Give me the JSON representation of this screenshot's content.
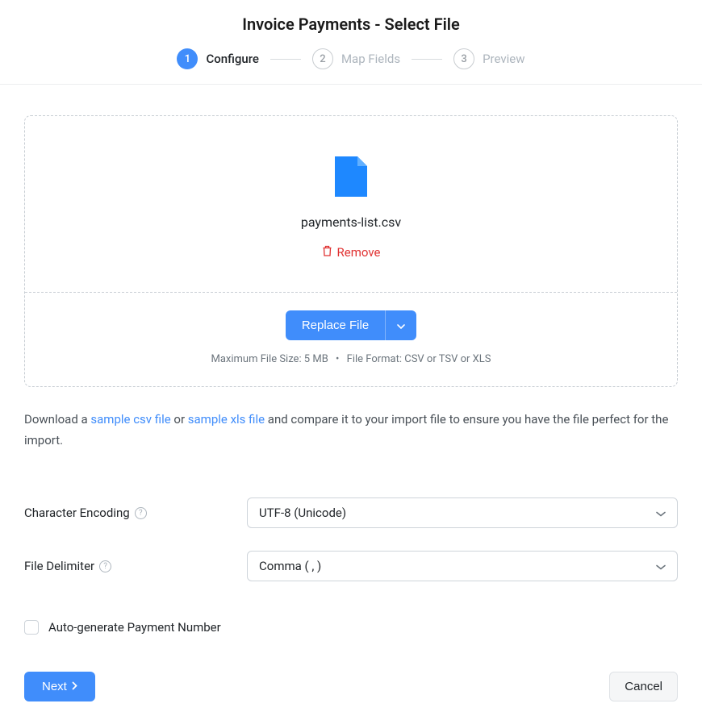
{
  "header": {
    "title": "Invoice Payments - Select File"
  },
  "stepper": {
    "steps": [
      {
        "num": "1",
        "label": "Configure",
        "active": true
      },
      {
        "num": "2",
        "label": "Map Fields",
        "active": false
      },
      {
        "num": "3",
        "label": "Preview",
        "active": false
      }
    ]
  },
  "upload": {
    "filename": "payments-list.csv",
    "remove_label": "Remove",
    "replace_label": "Replace File",
    "meta_size": "Maximum File Size: 5 MB",
    "meta_format": "File Format: CSV or TSV or XLS"
  },
  "hint": {
    "pre": "Download a ",
    "link_csv": "sample csv file",
    "mid1": " or ",
    "link_xls": "sample xls file",
    "post": " and compare it to your import file to ensure you have the file perfect for the import."
  },
  "form": {
    "encoding_label": "Character Encoding",
    "encoding_value": "UTF-8 (Unicode)",
    "delimiter_label": "File Delimiter",
    "delimiter_value": "Comma ( , )",
    "autogen_label": "Auto-generate Payment Number"
  },
  "footer": {
    "next": "Next",
    "cancel": "Cancel"
  }
}
